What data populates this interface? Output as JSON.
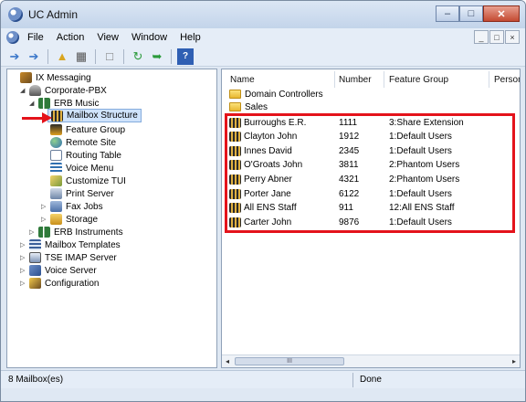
{
  "window": {
    "title": "UC Admin"
  },
  "menu": [
    "File",
    "Action",
    "View",
    "Window",
    "Help"
  ],
  "mdi_controls": [
    "_",
    "□",
    "×"
  ],
  "toolbar": {
    "icons": [
      "back-arrow-icon",
      "forward-arrow-icon",
      "folder-up-icon",
      "properties-icon",
      "clipboard-icon",
      "refresh-icon",
      "export-icon",
      "help-icon"
    ]
  },
  "tree": [
    {
      "label": "IX Messaging",
      "indent": 0,
      "icon": "messaging-icon",
      "expander": ""
    },
    {
      "label": "Corporate-PBX",
      "indent": 1,
      "icon": "pbx-icon",
      "expander": "◢"
    },
    {
      "label": "ERB Music",
      "indent": 2,
      "icon": "erb-music-icon",
      "expander": "◢"
    },
    {
      "label": "Mailbox Structure",
      "indent": 3,
      "icon": "mailbox-structure-icon",
      "expander": "",
      "selected": true
    },
    {
      "label": "Feature Group",
      "indent": 3,
      "icon": "feature-group-icon",
      "expander": ""
    },
    {
      "label": "Remote Site",
      "indent": 3,
      "icon": "remote-site-icon",
      "expander": ""
    },
    {
      "label": "Routing Table",
      "indent": 3,
      "icon": "routing-table-icon",
      "expander": ""
    },
    {
      "label": "Voice Menu",
      "indent": 3,
      "icon": "voice-menu-icon",
      "expander": ""
    },
    {
      "label": "Customize TUI",
      "indent": 3,
      "icon": "customize-tui-icon",
      "expander": ""
    },
    {
      "label": "Print Server",
      "indent": 3,
      "icon": "print-server-icon",
      "expander": ""
    },
    {
      "label": "Fax Jobs",
      "indent": 3,
      "icon": "fax-jobs-icon",
      "expander": "▷"
    },
    {
      "label": "Storage",
      "indent": 3,
      "icon": "storage-icon",
      "expander": "▷"
    },
    {
      "label": "ERB Instruments",
      "indent": 2,
      "icon": "erb-instruments-icon",
      "expander": "▷"
    },
    {
      "label": "Mailbox Templates",
      "indent": 1,
      "icon": "mailbox-templates-icon",
      "expander": "▷"
    },
    {
      "label": "TSE IMAP Server",
      "indent": 1,
      "icon": "imap-server-icon",
      "expander": "▷"
    },
    {
      "label": "Voice Server",
      "indent": 1,
      "icon": "voice-server-icon",
      "expander": "▷"
    },
    {
      "label": "Configuration",
      "indent": 1,
      "icon": "configuration-icon",
      "expander": "▷"
    }
  ],
  "columns": [
    "Name",
    "Number",
    "Feature Group",
    "Persona"
  ],
  "folders": [
    "Domain Controllers",
    "Sales"
  ],
  "mailboxes": [
    {
      "name": "Burroughs E.R.",
      "number": "1111",
      "feature_group": "3:Share Extension"
    },
    {
      "name": "Clayton John",
      "number": "1912",
      "feature_group": "1:Default Users"
    },
    {
      "name": "Innes David",
      "number": "2345",
      "feature_group": "1:Default Users"
    },
    {
      "name": "O'Groats John",
      "number": "3811",
      "feature_group": "2:Phantom Users"
    },
    {
      "name": "Perry Abner",
      "number": "4321",
      "feature_group": "2:Phantom Users"
    },
    {
      "name": "Porter Jane",
      "number": "6122",
      "feature_group": "1:Default Users"
    },
    {
      "name": "All ENS Staff",
      "number": "911",
      "feature_group": "12:All ENS Staff"
    },
    {
      "name": "Carter John",
      "number": "9876",
      "feature_group": "1:Default Users"
    }
  ],
  "hscroll": {
    "thumb": "III",
    "left": "◂",
    "right": "▸"
  },
  "status": {
    "count": "8 Mailbox(es)",
    "state": "Done"
  },
  "colors": {
    "highlight": "#e4131b",
    "selection": "#cfe3fb"
  }
}
